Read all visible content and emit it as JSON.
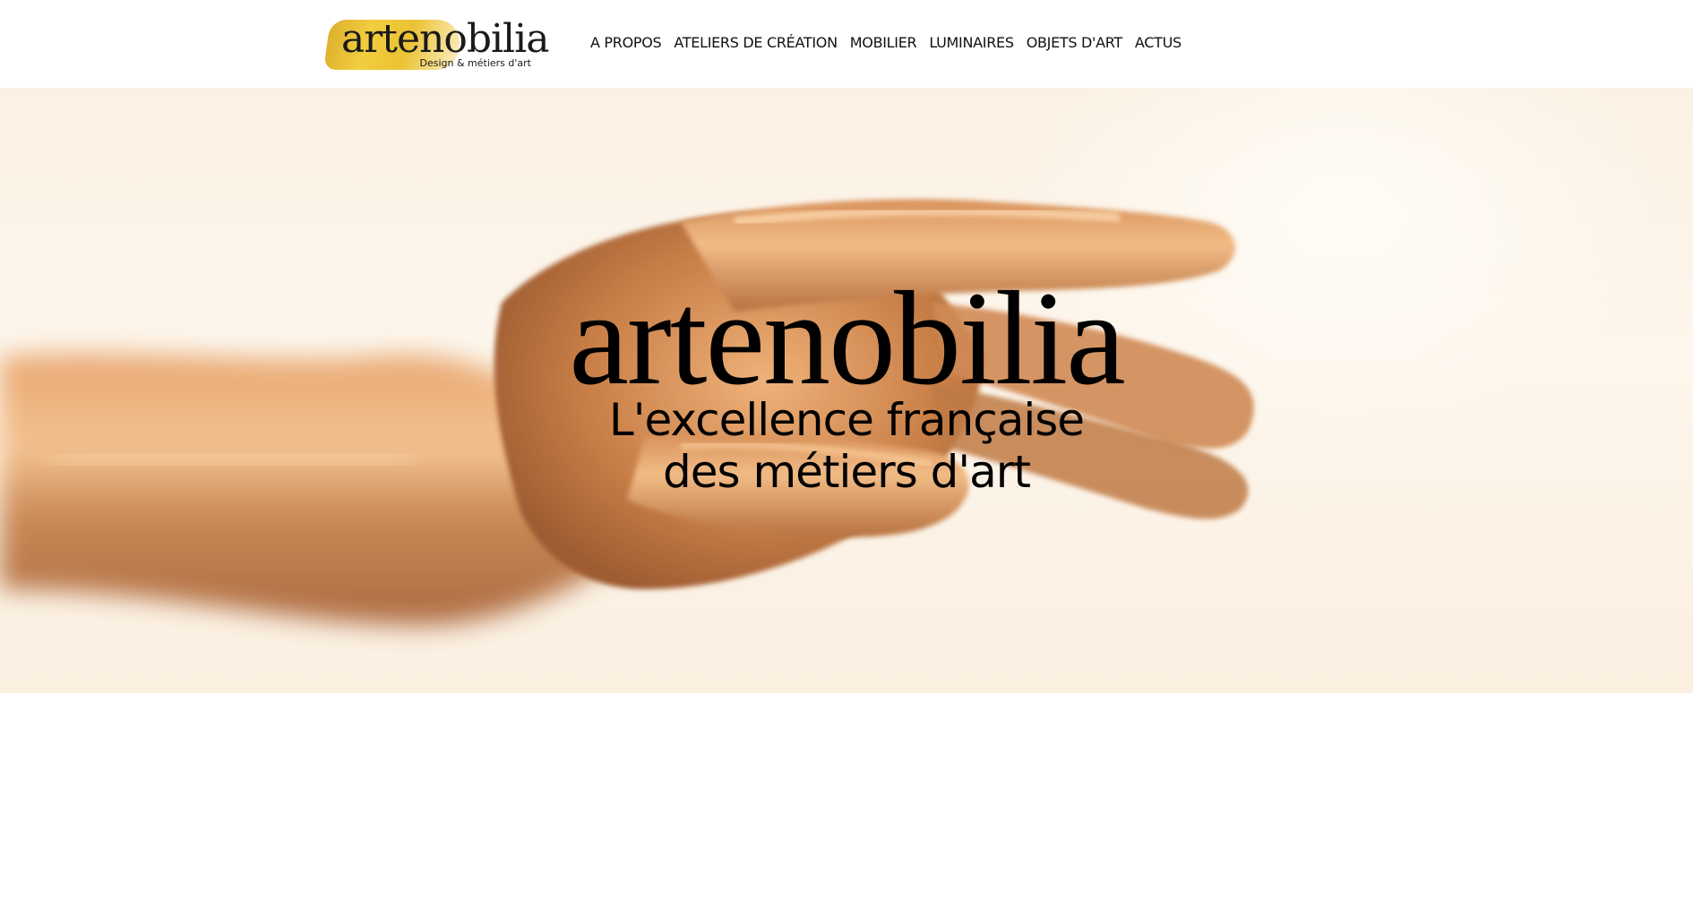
{
  "logo": {
    "wordmark": "artenobilia",
    "tagline": "Design & métiers d'art"
  },
  "nav": {
    "items": [
      {
        "label": "A PROPOS"
      },
      {
        "label": "ATELIERS DE CRÉATION"
      },
      {
        "label": "MOBILIER"
      },
      {
        "label": "LUMINAIRES"
      },
      {
        "label": "OBJETS D'ART"
      },
      {
        "label": "ACTUS"
      }
    ]
  },
  "hero": {
    "title": "artenobilia",
    "subtitle_line1": "L'excellence française",
    "subtitle_line2": "des métiers d'art",
    "image": "gold-painted-hand-photo"
  },
  "colors": {
    "gold": "#c9853f",
    "gold_highlight": "#f6c78e",
    "logo_brush": "#e9bd22",
    "background": "#ffffff"
  }
}
